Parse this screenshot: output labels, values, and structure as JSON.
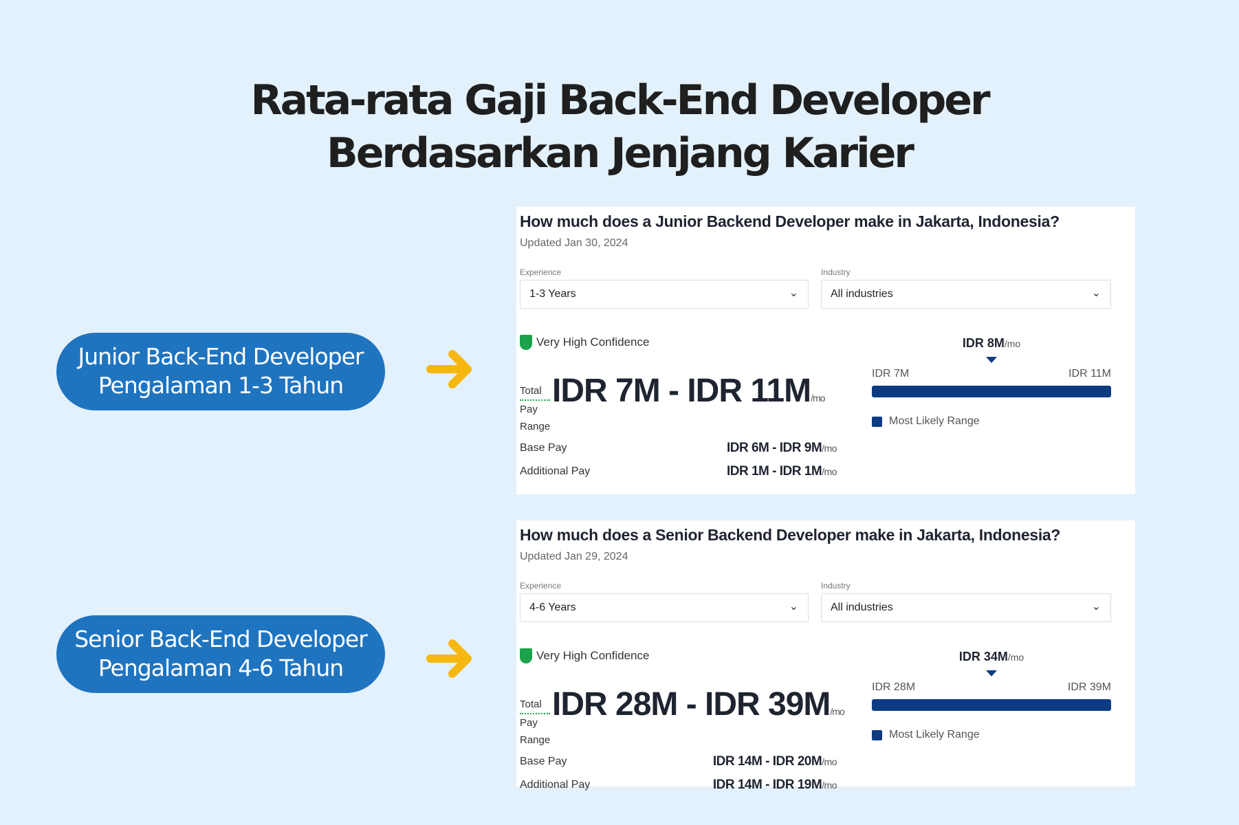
{
  "title": {
    "line1": "Rata-rata Gaji Back-End Developer",
    "line2": "Berdasarkan Jenjang Karier"
  },
  "colors": {
    "background": "#e3f1fc",
    "pill": "#1f74c0",
    "arrow": "#f7b711",
    "bar": "#0d3b82",
    "confidence": "#1aa34a"
  },
  "levels": [
    {
      "pill_line1": "Junior Back-End Developer",
      "pill_line2": "Pengalaman 1-3 Tahun",
      "card": {
        "question": "How much does a Junior Backend Developer make in Jakarta, Indonesia?",
        "updated": "Updated Jan 30, 2024",
        "experience_label": "Experience",
        "experience_value": "1-3 Years",
        "industry_label": "Industry",
        "industry_value": "All industries",
        "confidence": "Very High Confidence",
        "total_label_1": "Total",
        "total_label_2": "Pay",
        "total_label_3": "Range",
        "total_range": "IDR 7M - IDR 11M",
        "per": "/mo",
        "base_label": "Base Pay",
        "base_value": "IDR 6M - IDR 9M",
        "additional_label": "Additional Pay",
        "additional_value": "IDR 1M - IDR 1M",
        "median": "IDR 8M",
        "range_low": "IDR 7M",
        "range_high": "IDR 11M",
        "legend": "Most Likely Range"
      }
    },
    {
      "pill_line1": "Senior Back-End Developer",
      "pill_line2": "Pengalaman 4-6 Tahun",
      "card": {
        "question": "How much does a Senior Backend Developer make in Jakarta, Indonesia?",
        "updated": "Updated Jan 29, 2024",
        "experience_label": "Experience",
        "experience_value": "4-6 Years",
        "industry_label": "Industry",
        "industry_value": "All industries",
        "confidence": "Very High Confidence",
        "total_label_1": "Total",
        "total_label_2": "Pay",
        "total_label_3": "Range",
        "total_range": "IDR 28M - IDR 39M",
        "per": "/mo",
        "base_label": "Base Pay",
        "base_value": "IDR 14M - IDR 20M",
        "additional_label": "Additional Pay",
        "additional_value": "IDR 14M - IDR 19M",
        "median": "IDR 34M",
        "range_low": "IDR 28M",
        "range_high": "IDR 39M",
        "legend": "Most Likely Range"
      }
    }
  ]
}
